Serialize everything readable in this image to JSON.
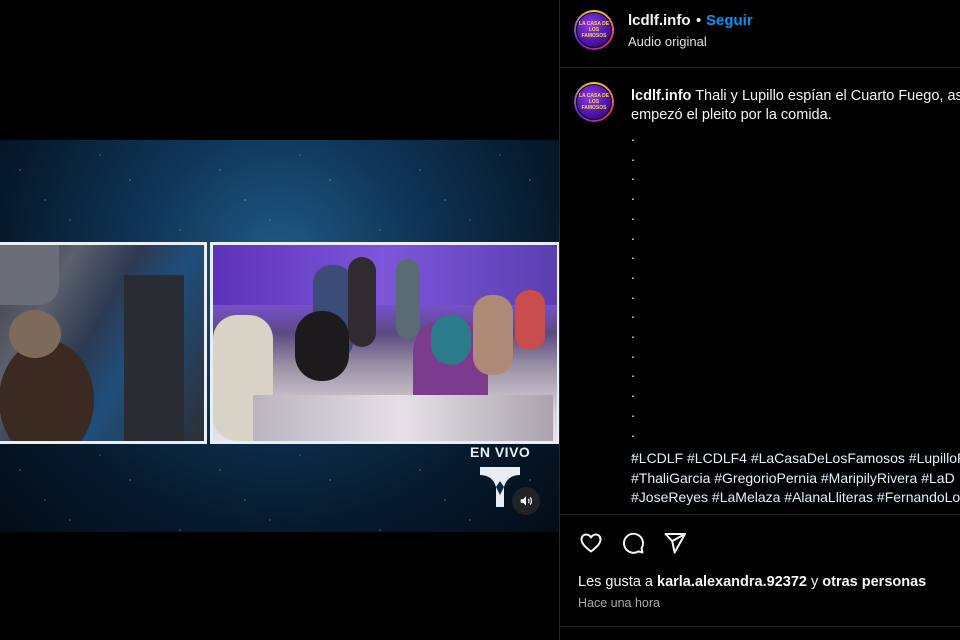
{
  "video": {
    "live_label": "EN VIVO",
    "volume_icon": "volume-icon"
  },
  "header": {
    "username": "lcdlf.info",
    "separator": "•",
    "follow_label": "Seguir",
    "audio_label": "Audio original",
    "avatar_text": "LA CASA DE LOS FAMOSOS"
  },
  "caption": {
    "username": "lcdlf.info",
    "text_line1": "Thali y Lupillo espían el Cuarto Fuego, as",
    "text_line2": "empezó el pleito por la comida.",
    "dots": [
      ".",
      ".",
      ".",
      ".",
      ".",
      ".",
      ".",
      ".",
      ".",
      ".",
      ".",
      ".",
      ".",
      ".",
      ".",
      ".",
      "."
    ],
    "hashtags_line1": "#LCDLF #LCDLF4 #LaCasaDeLosFamosos #LupilloR",
    "hashtags_line2": "#ThaliGarcia #GregorioPernia #MaripilyRivera #LaD",
    "hashtags_line3": "#JoseReyes #LaMelaza #AlanaLliteras #FernandoLo"
  },
  "actions": {
    "like_icon": "heart-icon",
    "comment_icon": "comment-icon",
    "share_icon": "send-icon"
  },
  "likes": {
    "prefix": "Les gusta a ",
    "user": "karla.alexandra.92372",
    "middle": " y ",
    "suffix": "otras personas"
  },
  "timestamp": "Hace una hora",
  "colors": {
    "accent": "#0095f6",
    "background": "#000000",
    "text": "#f5f5f5",
    "muted": "#a8a8a8"
  }
}
